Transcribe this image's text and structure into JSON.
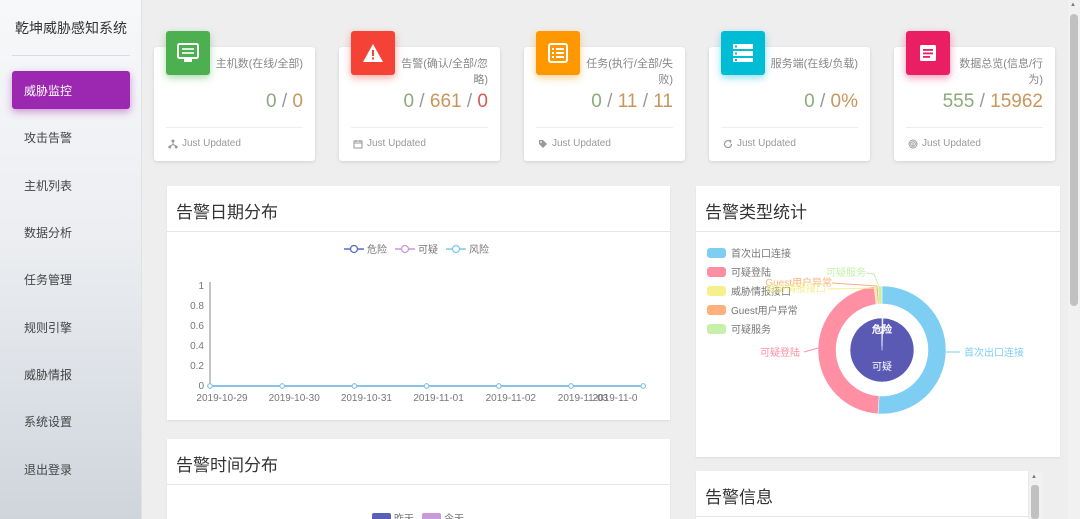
{
  "app": {
    "title": "乾坤威胁感知系统"
  },
  "sidebar": {
    "items": [
      {
        "label": "威胁监控",
        "active": true
      },
      {
        "label": "攻击告警"
      },
      {
        "label": "主机列表"
      },
      {
        "label": "数据分析"
      },
      {
        "label": "任务管理"
      },
      {
        "label": "规则引擎"
      },
      {
        "label": "威胁情报"
      },
      {
        "label": "系统设置"
      },
      {
        "label": "退出登录"
      }
    ]
  },
  "cards": [
    {
      "title": "主机数(在线/全部)",
      "v1": "0",
      "sep1": " / ",
      "v2": "0",
      "sep2": "",
      "v3": "",
      "footer": "Just Updated",
      "color": "#4caf50",
      "icon": "monitor-icon",
      "footer_icon": "sitemap-icon"
    },
    {
      "title": "告警(确认/全部/忽略)",
      "v1": "0",
      "sep1": " / ",
      "v2": "661",
      "sep2": " / ",
      "v3": "0",
      "footer": "Just Updated",
      "color": "#f44336",
      "icon": "warning-icon",
      "footer_icon": "calendar-icon"
    },
    {
      "title": "任务(执行/全部/失败)",
      "v1": "0",
      "sep1": " / ",
      "v2": "11",
      "sep2": " / ",
      "v3": "11",
      "footer": "Just Updated",
      "color": "#ff9800",
      "icon": "list-icon",
      "footer_icon": "tag-icon"
    },
    {
      "title": "服务端(在线/负载)",
      "v1": "0",
      "sep1": " / ",
      "v2": "0%",
      "sep2": "",
      "v3": "",
      "footer": "Just Updated",
      "color": "#00bcd4",
      "icon": "server-icon",
      "footer_icon": "refresh-icon"
    },
    {
      "title": "数据总览(信息/行为)",
      "v1": "555",
      "sep1": " / ",
      "v2": "15962",
      "sep2": "",
      "v3": "",
      "footer": "Just Updated",
      "color": "#e91e63",
      "icon": "document-icon",
      "footer_icon": "fingerprint-icon"
    }
  ],
  "alert_date_panel": {
    "title": "告警日期分布",
    "legend": [
      {
        "name": "危险",
        "color": "#5b6bc0"
      },
      {
        "name": "可疑",
        "color": "#c89ad8"
      },
      {
        "name": "风险",
        "color": "#7ec8e3"
      }
    ],
    "chart_data": {
      "type": "line",
      "x": [
        "2019-10-29",
        "2019-10-30",
        "2019-10-31",
        "2019-11-01",
        "2019-11-02",
        "2019-11-03",
        "2019-11-0"
      ],
      "series": [
        {
          "name": "危险",
          "values": [
            0,
            0,
            0,
            0,
            0,
            0,
            0
          ]
        },
        {
          "name": "可疑",
          "values": [
            0,
            0,
            0,
            0,
            0,
            0,
            0
          ]
        },
        {
          "name": "风险",
          "values": [
            0,
            0,
            0,
            0,
            0,
            0,
            0
          ]
        }
      ],
      "yticks": [
        "0",
        "0.2",
        "0.4",
        "0.6",
        "0.8",
        "1"
      ],
      "ylim": [
        0,
        1
      ]
    }
  },
  "alert_type_panel": {
    "title": "告警类型统计",
    "legend": [
      {
        "name": "首次出口连接",
        "color": "#7ecef4"
      },
      {
        "name": "可疑登陆",
        "color": "#ff8fa3"
      },
      {
        "name": "威胁情报接口",
        "color": "#f5f08b"
      },
      {
        "name": "Guest用户异常",
        "color": "#ffb07c"
      },
      {
        "name": "可疑服务",
        "color": "#c7f0a8"
      }
    ],
    "chart_data": {
      "type": "pie",
      "outer": [
        {
          "name": "首次出口连接",
          "value": 51,
          "color": "#7ecef4"
        },
        {
          "name": "可疑登陆",
          "value": 47,
          "color": "#ff8fa3"
        },
        {
          "name": "威胁情报接口",
          "value": 0.5,
          "color": "#f5f08b"
        },
        {
          "name": "Guest用户异常",
          "value": 0.5,
          "color": "#ffb07c"
        },
        {
          "name": "可疑服务",
          "value": 1,
          "color": "#c7f0a8"
        }
      ],
      "inner": [
        {
          "name": "危险",
          "value": 0.5,
          "color": "#5a5ab5"
        },
        {
          "name": "可疑",
          "value": 99.5,
          "color": "#5a5ab5"
        }
      ],
      "outer_labels": [
        "首次出口连接",
        "可疑登陆",
        "可疑服务",
        "Guest用户异常",
        "威胁情报接口"
      ],
      "inner_labels": [
        "危险",
        "可疑"
      ]
    }
  },
  "alert_time_panel": {
    "title": "告警时间分布",
    "legend": [
      {
        "name": "昨天",
        "color": "#5b5fb5"
      },
      {
        "name": "今天",
        "color": "#c89ad8"
      }
    ]
  },
  "alert_info_panel": {
    "title": "告警信息"
  }
}
